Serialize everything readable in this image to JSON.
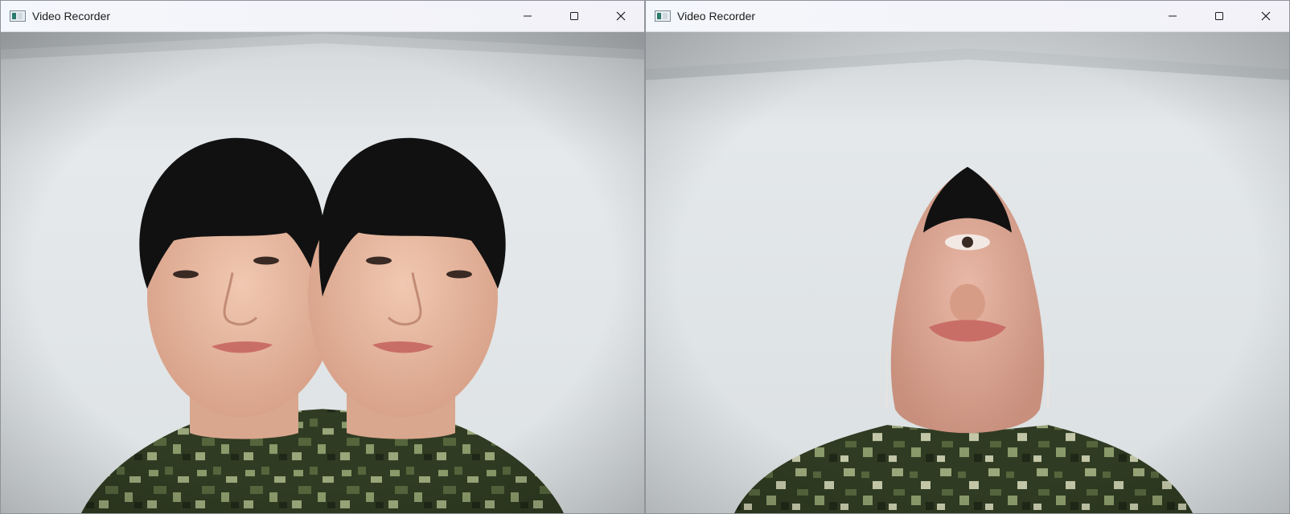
{
  "windows": [
    {
      "title": "Video Recorder",
      "icon": "app-window-icon",
      "controls": [
        "minimize-icon",
        "maximize-icon",
        "close-icon"
      ],
      "content": "webcam-feed-mirrored-face"
    },
    {
      "title": "Video Recorder",
      "icon": "app-window-icon",
      "controls": [
        "minimize-icon",
        "maximize-icon",
        "close-icon"
      ],
      "content": "webcam-feed-warped-face"
    }
  ],
  "colors": {
    "titlebar": "#f3f5f9",
    "wall": "#dfe3e6",
    "hair": "#111111",
    "skin": "#e7b7a0",
    "camo_dark": "#2f3b22",
    "camo_light": "#8a9a6a"
  }
}
